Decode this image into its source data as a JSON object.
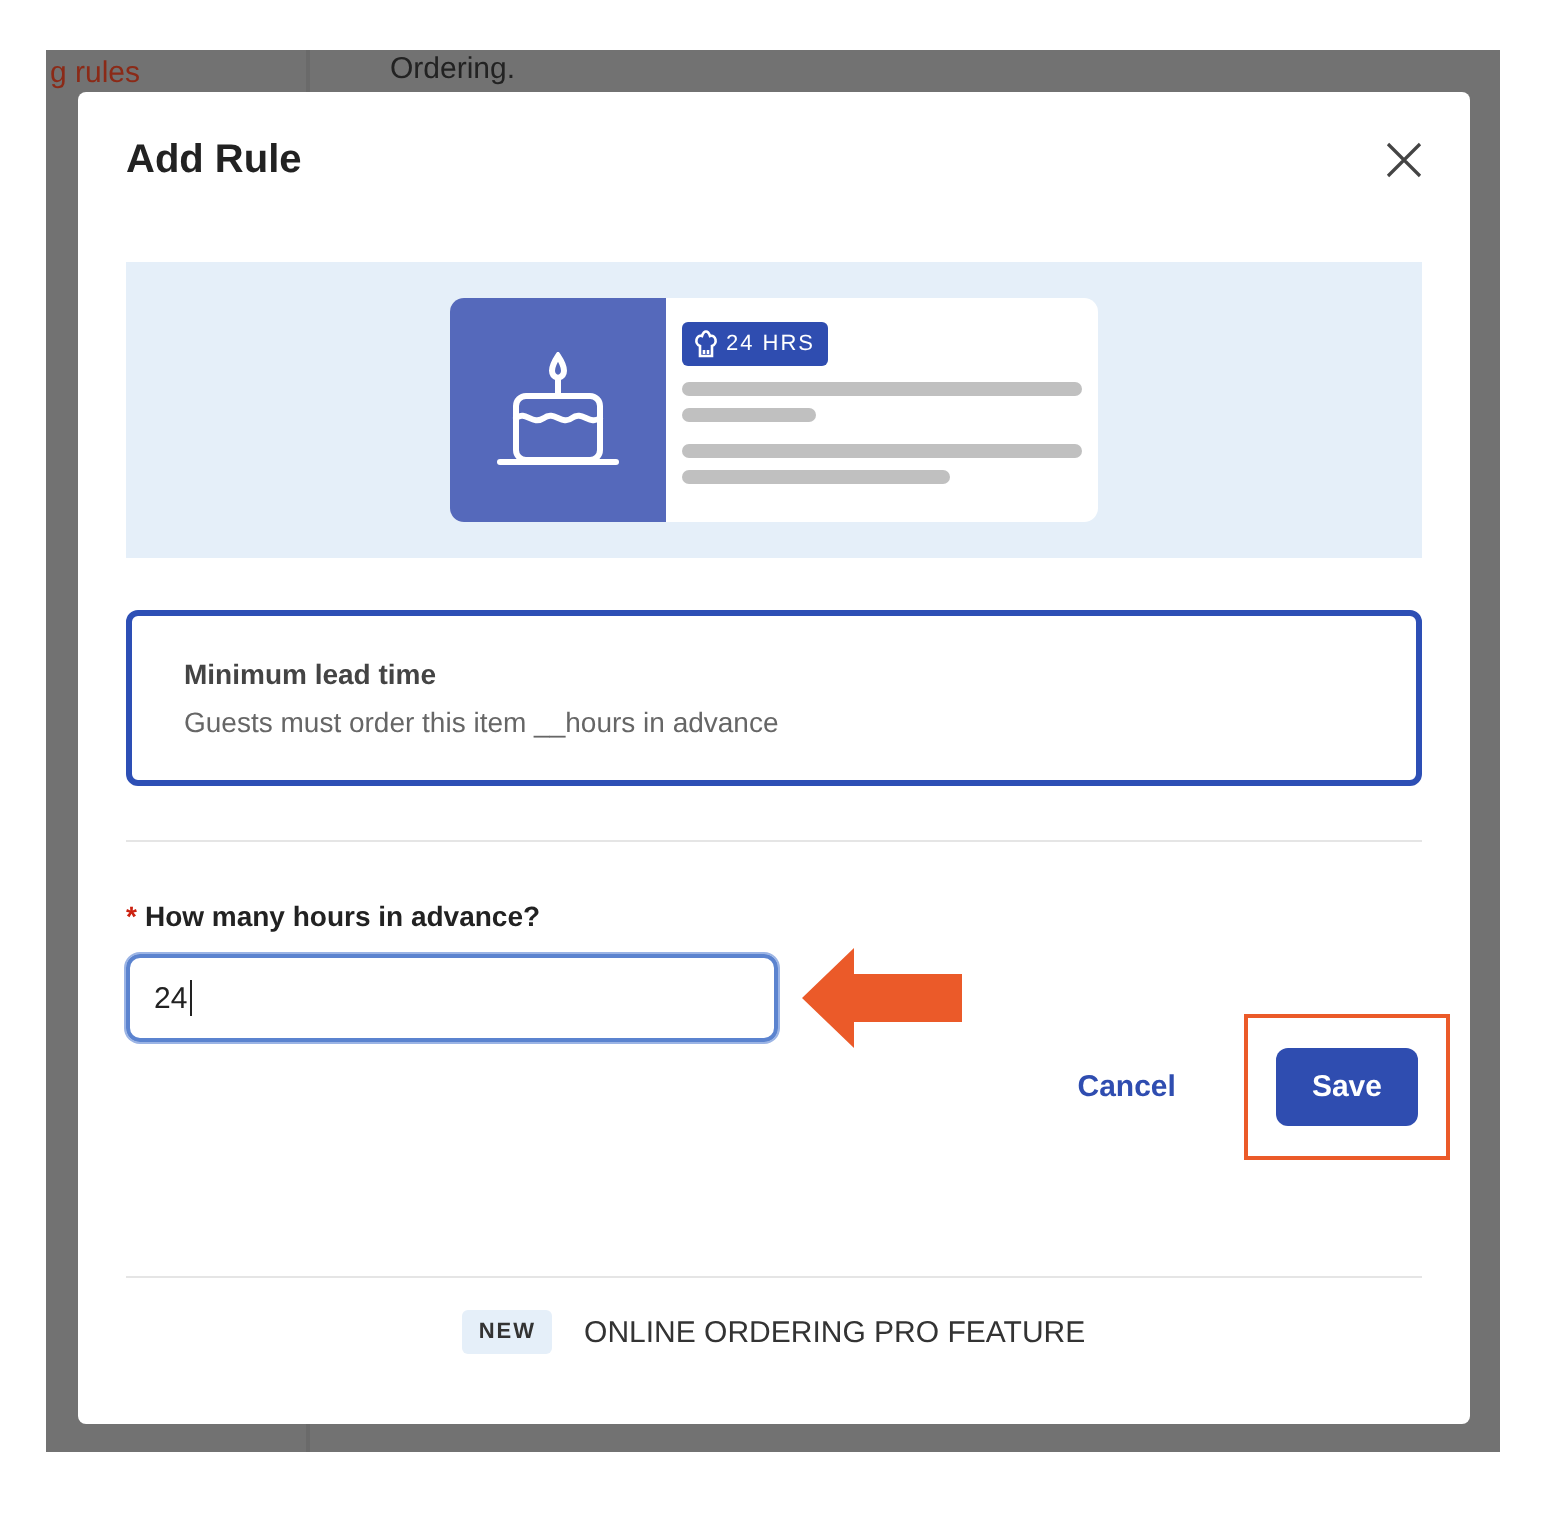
{
  "background": {
    "sidebar_link": "g rules",
    "heading": "Ordering."
  },
  "dialog": {
    "title": "Add Rule",
    "illustration": {
      "badge": "24 HRS"
    },
    "rule_option": {
      "title": "Minimum lead time",
      "description": "Guests must order this item __hours in advance",
      "selected": true
    },
    "field": {
      "label": "How many hours in advance?",
      "required_mark": "*",
      "value": "24"
    },
    "buttons": [
      {
        "label": "Cancel",
        "kind": "link"
      },
      {
        "label": "Save",
        "kind": "primary",
        "highlighted": true
      }
    ],
    "footer": {
      "badge": "NEW",
      "text": "ONLINE ORDERING PRO FEATURE"
    }
  }
}
